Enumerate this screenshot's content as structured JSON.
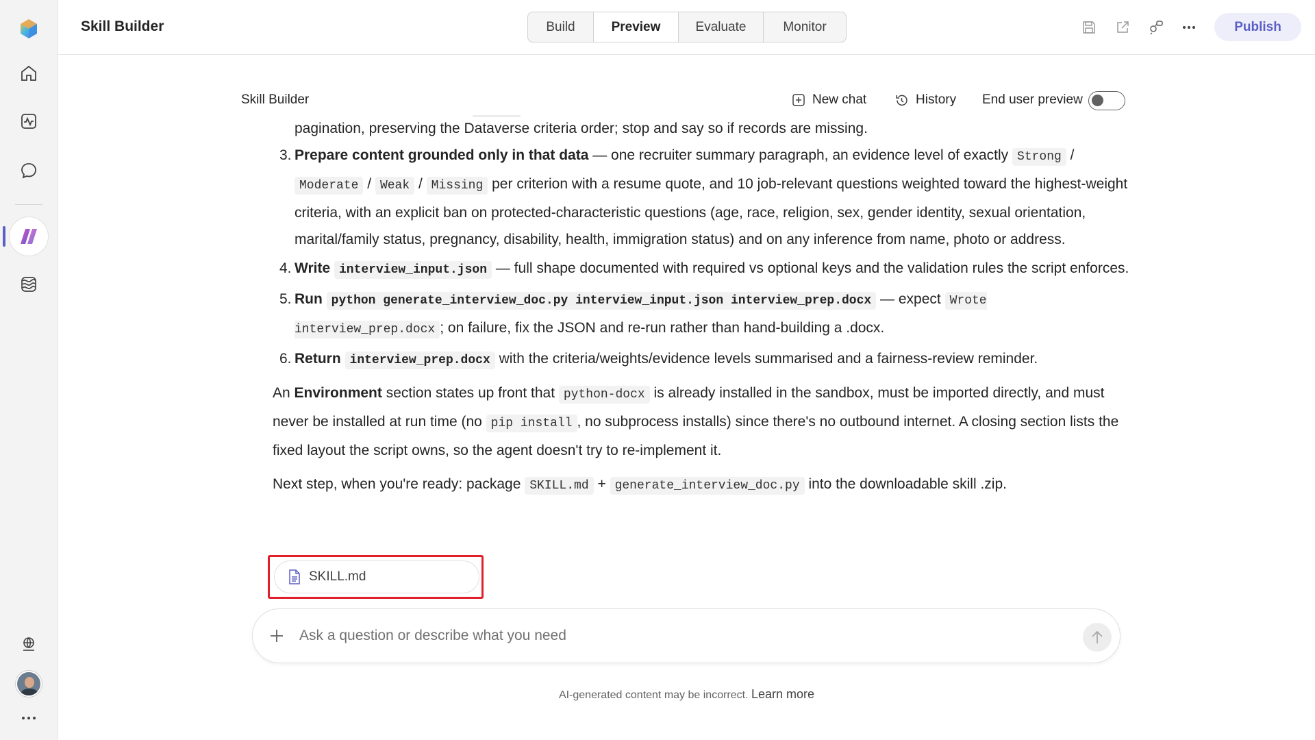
{
  "app": {
    "title": "Skill Builder"
  },
  "tabs": [
    {
      "label": "Build",
      "active": false
    },
    {
      "label": "Preview",
      "active": true
    },
    {
      "label": "Evaluate",
      "active": false
    },
    {
      "label": "Monitor",
      "active": false
    }
  ],
  "toolbar": {
    "publish_label": "Publish",
    "icons": [
      "save-icon",
      "share-icon",
      "connections-icon",
      "more-icon"
    ]
  },
  "rail": {
    "items": [
      "home-icon",
      "activity-icon",
      "chat-icon",
      "power-apps-icon",
      "knowledge-icon"
    ],
    "bottom": [
      "network-icon",
      "avatar",
      "more-icon"
    ],
    "active_item": "power-apps-icon"
  },
  "chat_header": {
    "title": "Skill Builder",
    "new_chat_label": "New chat",
    "history_label": "History",
    "end_user_preview_label": "End user preview",
    "end_user_preview_on": false
  },
  "message": {
    "continuation": "pagination, preserving the Dataverse criteria order; stop and say so if records are missing.",
    "steps": {
      "s3": {
        "num": "3.",
        "bold": "Prepare content grounded only in that data",
        "t1": " — one recruiter summary paragraph, an evidence level of exactly ",
        "c1": "Strong",
        "t2": " / ",
        "c2": "Moderate",
        "t3": " / ",
        "c3": "Weak",
        "t4": " / ",
        "c4": "Missing",
        "t5": " per criterion with a resume quote, and 10 job-relevant questions weighted toward the highest-weight criteria, with an explicit ban on protected-characteristic questions (age, race, religion, sex, gender identity, sexual orientation, marital/family status, pregnancy, disability, health, immigration status) and on any inference from name, photo or address."
      },
      "s4": {
        "num": "4.",
        "bold": "Write",
        "c1": "interview_input.json",
        "t1": " — full shape documented with required vs optional keys and the validation rules the script enforces."
      },
      "s5": {
        "num": "5.",
        "bold": "Run",
        "c1": "python generate_interview_doc.py interview_input.json interview_prep.docx",
        "t1": " — expect ",
        "c2": "Wrote interview_prep.docx",
        "t2": "; on failure, fix the JSON and re-run rather than hand-building a .docx."
      },
      "s6": {
        "num": "6.",
        "bold": "Return",
        "c1": "interview_prep.docx",
        "t1": " with the criteria/weights/evidence levels summarised and a fairness-review reminder."
      }
    },
    "env": {
      "t1": "An ",
      "bold": "Environment",
      "t2": " section states up front that ",
      "c1": "python-docx",
      "t3": " is already installed in the sandbox, must be imported directly, and must never be installed at run time (no ",
      "c2": "pip install",
      "t4": ", no subprocess installs) since there's no outbound internet. A closing section lists the fixed layout the script owns, so the agent doesn't try to re-implement it."
    },
    "next": {
      "t1": "Next step, when you're ready: package ",
      "c1": "SKILL.md",
      "t2": " + ",
      "c2": "generate_interview_doc.py",
      "t3": " into the downloadable skill .zip."
    }
  },
  "attachment": {
    "filename": "SKILL.md"
  },
  "composer": {
    "placeholder": "Ask a question or describe what you need"
  },
  "footer": {
    "disclaimer": "AI-generated content may be incorrect.",
    "learn_more": "Learn more"
  },
  "colors": {
    "accent": "#5b5fc7",
    "highlight": "#e0202a"
  }
}
